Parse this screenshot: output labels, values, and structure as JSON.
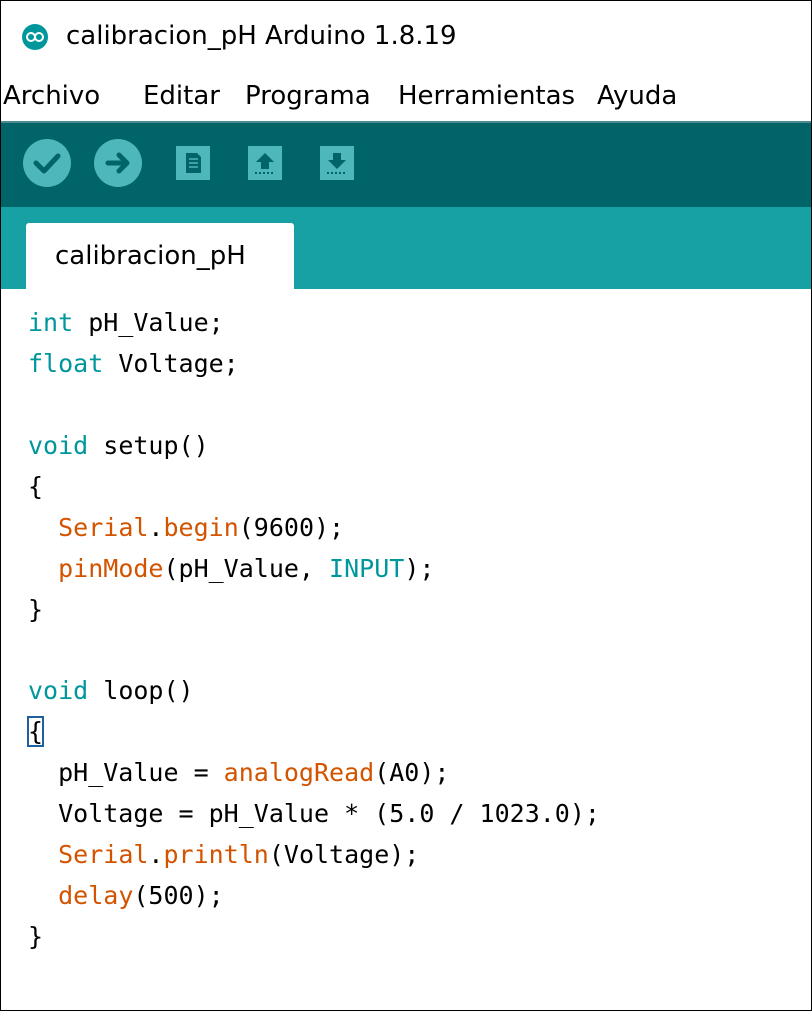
{
  "window": {
    "title": "calibracion_pH Arduino 1.8.19",
    "logo_icon": "arduino-logo-icon"
  },
  "menu": {
    "items": [
      "Archivo",
      "Editar",
      "Programa",
      "Herramientas",
      "Ayuda"
    ]
  },
  "toolbar": {
    "buttons": [
      {
        "name": "verify-button",
        "icon": "checkmark-icon"
      },
      {
        "name": "upload-button",
        "icon": "right-arrow-icon"
      },
      {
        "name": "new-button",
        "icon": "new-file-icon"
      },
      {
        "name": "open-button",
        "icon": "up-arrow-icon"
      },
      {
        "name": "save-button",
        "icon": "down-arrow-icon"
      }
    ]
  },
  "tabs": [
    {
      "label": "calibracion_pH",
      "active": true
    }
  ],
  "colors": {
    "toolbar_bg": "#006468",
    "tabstrip_bg": "#17a1a5",
    "button_bg": "#4db7bb",
    "keyword": "#00979c",
    "function": "#d35400"
  },
  "code": {
    "line1": {
      "kw": "int",
      "rest": " pH_Value;"
    },
    "line2": {
      "kw": "float",
      "rest": " Voltage;"
    },
    "line4": {
      "kw": "void",
      "rest": " setup()"
    },
    "line5": "{",
    "line6": {
      "indent": "  ",
      "obj": "Serial",
      "dot": ".",
      "fn": "begin",
      "rest": "(9600);"
    },
    "line7": {
      "indent": "  ",
      "fn": "pinMode",
      "mid": "(pH_Value, ",
      "const": "INPUT",
      "rest": ");"
    },
    "line8": "}",
    "line10": {
      "kw": "void",
      "rest": " loop()"
    },
    "line11": "{",
    "line12": {
      "pre": "  pH_Value = ",
      "fn": "analogRead",
      "rest": "(A0);"
    },
    "line13": "  Voltage = pH_Value * (5.0 / 1023.0);",
    "line14": {
      "indent": "  ",
      "obj": "Serial",
      "dot": ".",
      "fn": "println",
      "rest": "(Voltage);"
    },
    "line15": {
      "indent": "  ",
      "fn": "delay",
      "rest": "(500);"
    },
    "line16": "}"
  }
}
